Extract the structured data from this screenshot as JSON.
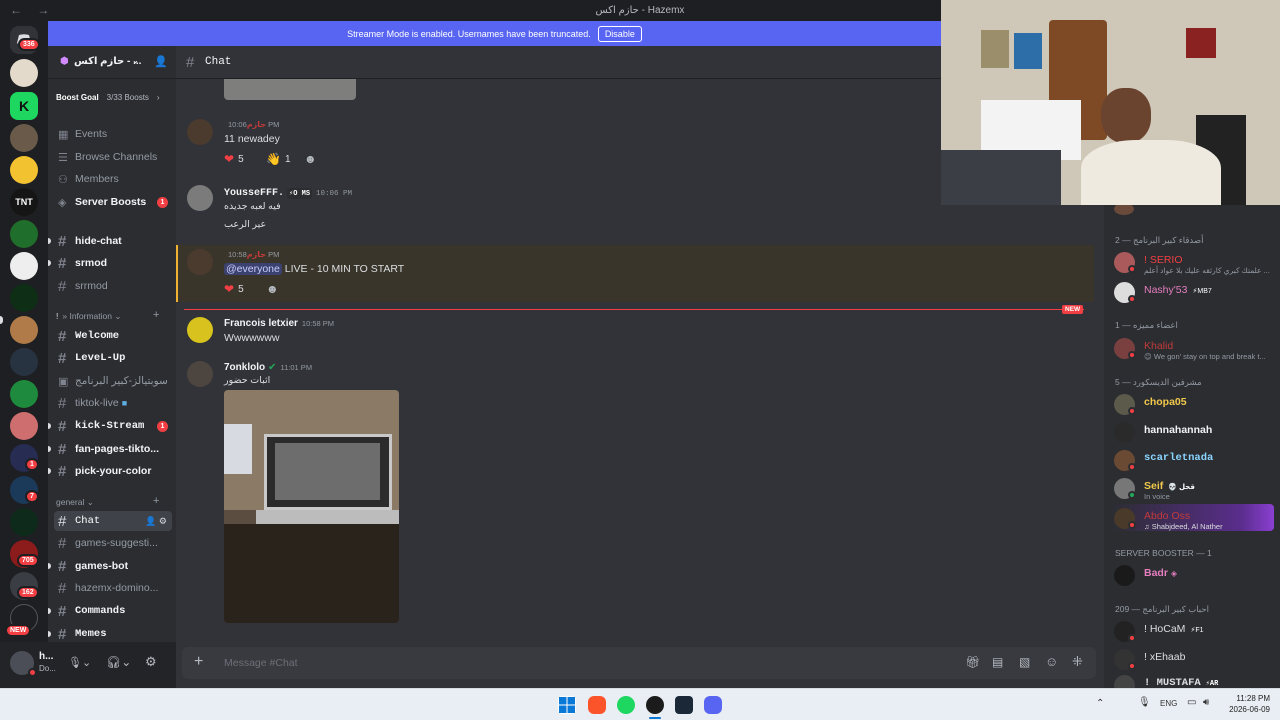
{
  "window": {
    "title": "حازم اكس - Hazemx"
  },
  "banner": {
    "text": "Streamer Mode is enabled. Usernames have been truncated.",
    "button": "Disable"
  },
  "rail": {
    "discord_badge": "336",
    "badges": [
      "1",
      "7",
      "705",
      "162",
      "NEW"
    ]
  },
  "server": {
    "name": "حازم اكس - ..."
  },
  "boost": {
    "label": "Boost Goal",
    "count": "3/33 Boosts"
  },
  "sidebar": {
    "events": "Events",
    "browse": "Browse Channels",
    "members": "Members",
    "boosts": "Server Boosts",
    "boosts_badge": "1",
    "channels_top": [
      "hide-chat",
      "srmod",
      "srrmod"
    ],
    "cat_information": "» Information",
    "channels_info": [
      "Welcome",
      "LeveL-Up",
      "سوبتيالز-كبير البرنامج",
      "tiktok-live",
      "kick-Stream",
      "fan-pages-tikto...",
      "pick-your-color"
    ],
    "kick_badge": "1",
    "cat_general": "general",
    "channels_general": [
      "Chat",
      "games-suggesti...",
      "games-bot",
      "hazemx-domino...",
      "Commands",
      "Memes"
    ]
  },
  "user": {
    "name": "h...",
    "status": "Do..."
  },
  "chat": {
    "channel": "Chat",
    "messages": [
      {
        "author": "حازم",
        "time": "10:06 PM",
        "text": "11 newadey",
        "reactions": [
          "5",
          "1"
        ]
      },
      {
        "author": "YousseFFF.",
        "tag": "⚡O MS",
        "time": "10:06 PM",
        "lines": [
          "فيه لعبه جديده",
          "عير الرعب"
        ]
      },
      {
        "author": "حازم",
        "time": "10:58 PM",
        "mention": "@everyone",
        "text": "LIVE - 10 MIN TO START",
        "reactions": [
          "5"
        ]
      },
      {
        "author": "Francois letxier",
        "time": "10:58 PM",
        "text": "Wwwwwww"
      },
      {
        "author": "7onklolo",
        "time": "11:01 PM",
        "text": "اثبات حضور"
      }
    ],
    "new_label": "NEW",
    "composer_placeholder": "Message #Chat"
  },
  "members": {
    "cat1": "أصدقاء كبير البرنامج — 2",
    "cat2": "اعضاء مميزه — 1",
    "cat3": "مشرفين الديسكورد — 5",
    "cat4": "SERVER BOOSTER — 1",
    "cat5": "احباب كبير البرنامج — 209",
    "list": [
      {
        "name": "! SERIO",
        "status": "علمتك كبري كارثقه عليك بلا عواد أعلم ...",
        "color": "#f23f43"
      },
      {
        "name": "Nashy'53",
        "tag": "⚡MB7",
        "color": "#e67ec0"
      },
      {
        "name": "Khalid",
        "status": "😊 We gon' stay on top and break t...",
        "color": "#c33a3a"
      },
      {
        "name": "chopa05",
        "color": "#f2c94c"
      },
      {
        "name": "hannahannah",
        "color": "#f2f3f5"
      },
      {
        "name": "scarletnada",
        "color": "#8ad5ff"
      },
      {
        "name": "Seif",
        "tag": "💀 قحل",
        "status": "In voice",
        "color": "#f2c94c"
      },
      {
        "name": "Abdo Oss",
        "status": "♫ Shabjdeed, Al Nather",
        "color": "#c33a3a"
      },
      {
        "name": "Badr",
        "color": "#e67ec0"
      },
      {
        "name": "! HoCaM",
        "tag": "⚡F1",
        "color": "#dbdee1"
      },
      {
        "name": "! xEhaab",
        "color": "#dbdee1"
      },
      {
        "name": "! MUSTAFA",
        "tag": "⚡AR",
        "color": "#dbdee1"
      }
    ]
  },
  "taskbar": {
    "lang": "ENG",
    "time": "11:28 PM",
    "date": "2026-06-09"
  }
}
